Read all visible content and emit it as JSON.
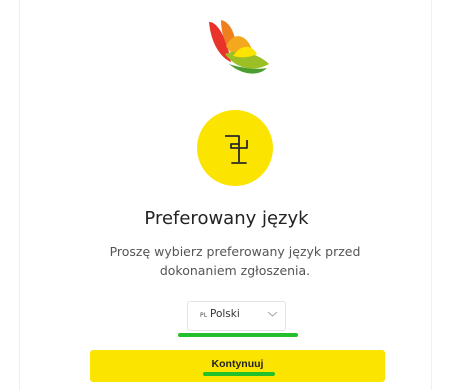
{
  "logo": {
    "icon": "butterfly-logo-icon"
  },
  "hero_icon": {
    "icon": "flag-icon",
    "color": "#fbe400"
  },
  "title": "Preferowany język",
  "subtitle": "Proszę wybierz preferowany język przed dokonaniem zgłoszenia.",
  "language_select": {
    "code": "PL",
    "value": "Polski",
    "icon": "chevron-down-icon"
  },
  "continue_button": {
    "label": "Kontynuuj",
    "color": "#fbe400"
  },
  "highlight_color": "#22c02b"
}
